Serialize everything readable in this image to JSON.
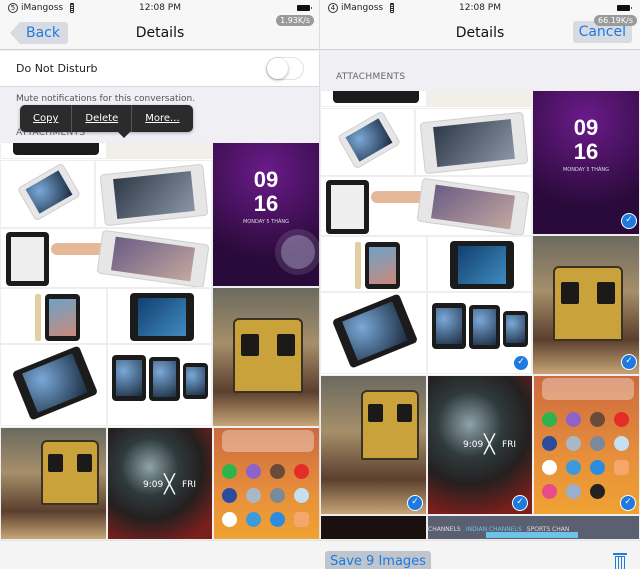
{
  "left_screen": {
    "status_bar": {
      "notification_count": "5",
      "carrier": "iMangoss",
      "time": "12:08 PM",
      "network_speed": "1.93K/s"
    },
    "nav": {
      "back_label": "Back",
      "title": "Details"
    },
    "do_not_disturb": {
      "label": "Do Not Disturb",
      "enabled": false
    },
    "mute_note": "Mute notifications for this conversation.",
    "attachments_header": "ATTACHMENTS",
    "context_menu": {
      "items": [
        "Copy",
        "Delete",
        "More..."
      ]
    },
    "tiles": {
      "lockscreen_hour": "09",
      "lockscreen_minute": "16",
      "lockscreen_date": "MONDAY 5 THÁNG",
      "blur_time": "9:09",
      "blur_day": "FRI"
    }
  },
  "right_screen": {
    "status_bar": {
      "notification_count": "4",
      "carrier": "iMangoss",
      "time": "12:08 PM",
      "network_speed": "66.19K/s"
    },
    "nav": {
      "title": "Details",
      "cancel_label": "Cancel"
    },
    "attachments_header": "ATTACHMENTS",
    "selected_count": 9,
    "tiles": {
      "lockscreen_hour": "09",
      "lockscreen_minute": "16",
      "lockscreen_date": "MONDAY 5 THÁNG",
      "blur_time": "9:09",
      "blur_day": "FRI",
      "banner_labels": [
        "CHANNELS",
        "INDIAN CHANNELS",
        "SPORTS CHAN"
      ]
    },
    "check_mark": "✓"
  },
  "toolbar": {
    "save_label": "Save 9 Images",
    "delete_icon": "trash-icon"
  },
  "colors": {
    "accent": "#1e7ae0",
    "button_bg": "#d8dce2",
    "popup_bg": "#2b2b2b"
  }
}
